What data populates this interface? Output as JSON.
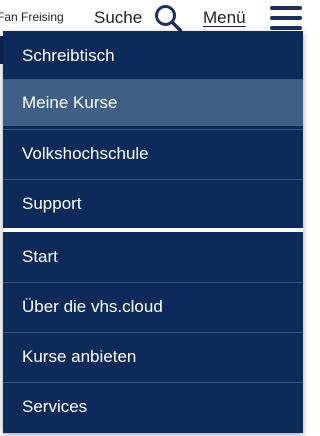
{
  "header": {
    "org_name": "Fan Freising",
    "search_label": "Suche",
    "menu_label": "Menü"
  },
  "menu": {
    "group1": [
      {
        "label": "Schreibtisch",
        "active": false
      },
      {
        "label": "Meine Kurse",
        "active": true
      },
      {
        "label": "Volkshochschule",
        "active": false
      },
      {
        "label": "Support",
        "active": false
      }
    ],
    "group2": [
      {
        "label": "Start",
        "active": false
      },
      {
        "label": "Über die vhs.cloud",
        "active": false
      },
      {
        "label": "Kurse anbieten",
        "active": false
      },
      {
        "label": "Services",
        "active": false
      }
    ]
  },
  "colors": {
    "menu_bg": "#0d2a5a",
    "menu_active": "#3f5f86",
    "text_on_menu": "#ffffff"
  }
}
